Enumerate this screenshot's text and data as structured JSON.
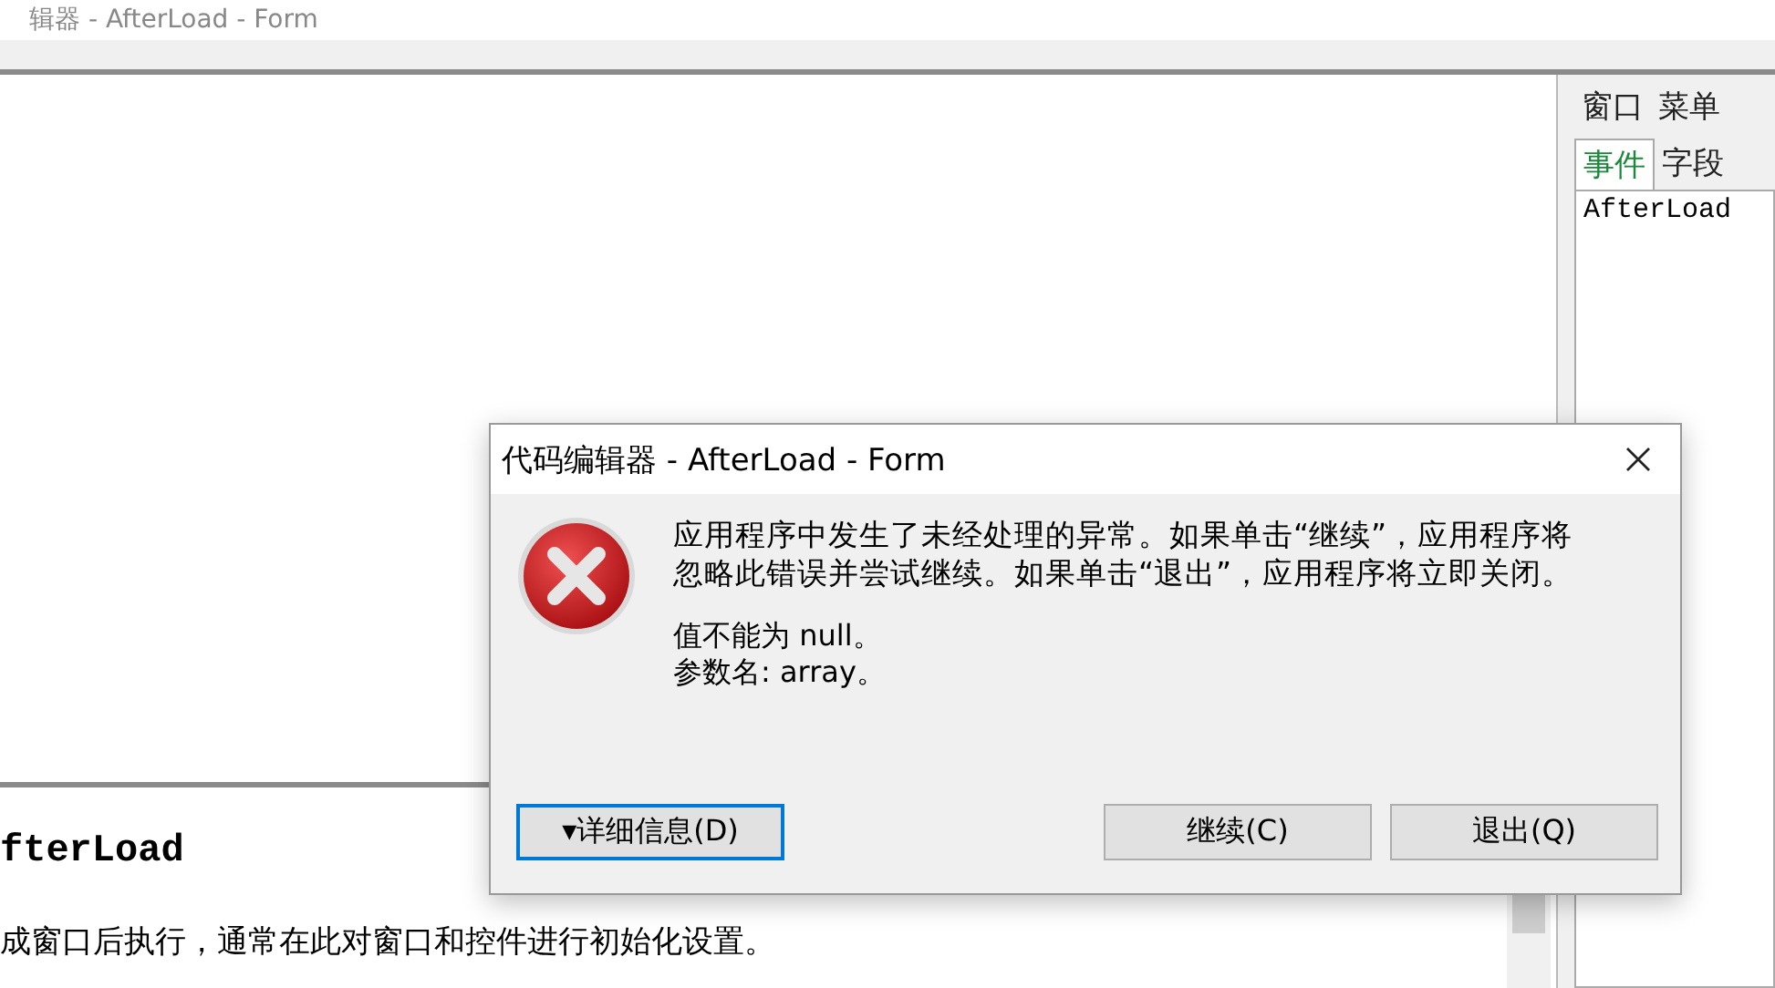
{
  "window": {
    "title": "辑器 - AfterLoad - Form"
  },
  "side_panel": {
    "tab_rows": [
      [
        {
          "label": "窗口",
          "selected": false
        },
        {
          "label": "菜单",
          "selected": false
        }
      ],
      [
        {
          "label": "事件",
          "selected": true
        },
        {
          "label": "字段",
          "selected": false
        }
      ]
    ],
    "items": [
      "AfterLoad"
    ]
  },
  "doc_pane": {
    "heading": "fterLoad",
    "description": "成窗口后执行，通常在此对窗口和控件进行初始化设置。"
  },
  "dialog": {
    "title": "代码编辑器 - AfterLoad - Form",
    "message": "应用程序中发生了未经处理的异常。如果单击“继续”，应用程序将忽略此错误并尝试继续。如果单击“退出”，应用程序将立即关闭。",
    "details": [
      "值不能为 null。",
      "参数名: array。"
    ],
    "buttons": [
      {
        "label": "▾详细信息(D)",
        "focused": true
      },
      {
        "label": "继续(C)",
        "focused": false
      },
      {
        "label": "退出(Q)",
        "focused": false
      }
    ]
  }
}
